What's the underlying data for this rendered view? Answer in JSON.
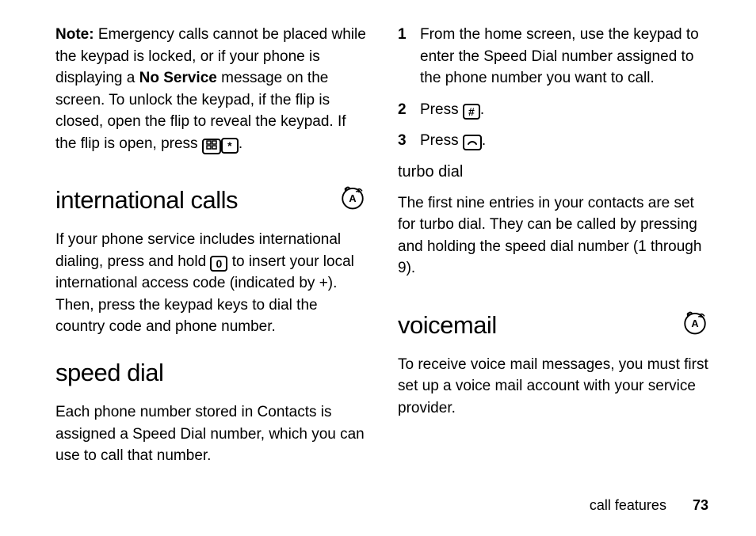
{
  "left": {
    "note_label": "Note:",
    "note_text_before": " Emergency calls cannot be placed while the keypad is locked, or if your phone is displaying a ",
    "no_service": "No Service",
    "note_text_after": " message on the screen. To unlock the keypad, if the flip is closed, open the flip to reveal the keypad. If the flip is open, press ",
    "note_period": ".",
    "icon_menu_name": "menu-key-icon",
    "icon_star_name": "star-key-icon",
    "h_intl": "international calls",
    "intl_before": "If your phone service includes international dialing, press and hold ",
    "intl_after": " to insert your local international access code (indicated by +). Then, press the keypad keys to dial the country code and phone number.",
    "key_zero": "0",
    "h_speed": "speed dial",
    "speed_text": "Each phone number stored in Contacts is assigned a Speed Dial number, which you can use to call that number."
  },
  "right": {
    "step1": "From the home screen, use the keypad to enter the Speed Dial number assigned to the phone number you want to call.",
    "step2_before": "Press ",
    "step2_key": "#",
    "step2_after": ".",
    "step3_before": "Press ",
    "step3_after": ".",
    "h_turbo": "turbo dial",
    "turbo_text": "The first nine entries in your contacts are set for turbo dial. They can be called by pressing and holding the speed dial number (1 through 9).",
    "h_vm": "voicemail",
    "vm_text": "To receive voice mail messages, you must first set up a voice mail account with your service provider."
  },
  "nums": {
    "n1": "1",
    "n2": "2",
    "n3": "3"
  },
  "footer": {
    "section": "call features",
    "page": "73"
  },
  "icons": {
    "network_badge": "network-badge-icon"
  }
}
